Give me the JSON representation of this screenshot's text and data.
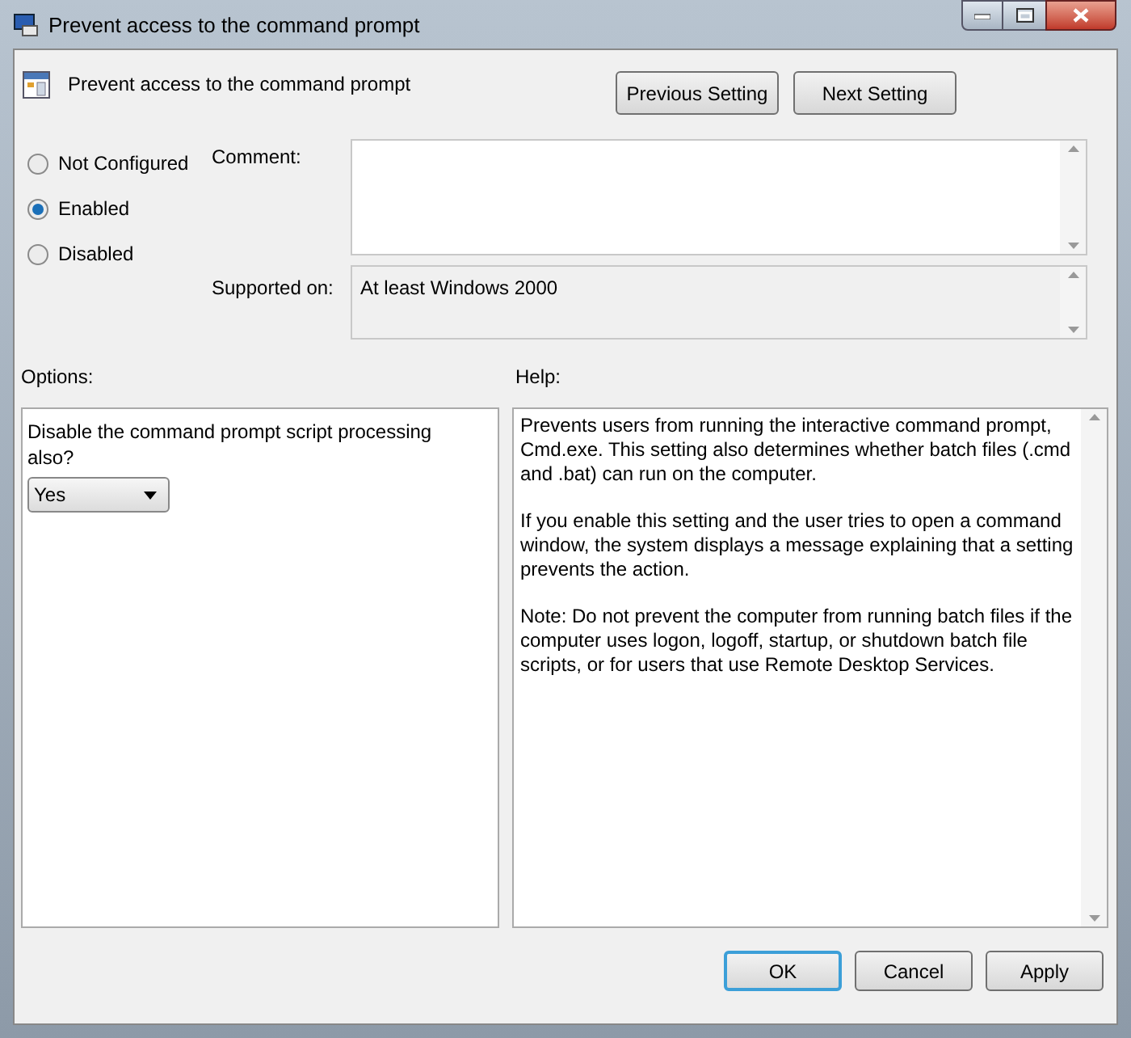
{
  "window": {
    "title": "Prevent access to the command prompt"
  },
  "header": {
    "title": "Prevent access to the command prompt"
  },
  "nav_buttons": [
    "Previous Setting",
    "Next Setting"
  ],
  "states": [
    {
      "label": "Not Configured",
      "selected": false
    },
    {
      "label": "Enabled",
      "selected": true
    },
    {
      "label": "Disabled",
      "selected": false
    }
  ],
  "comment": {
    "label": "Comment:"
  },
  "supported_on": {
    "label": "Supported on:",
    "value": "At least Windows 2000"
  },
  "options": {
    "label": "Options:",
    "prompt": "Disable the command prompt script processing also?",
    "dropdown": "Yes"
  },
  "help": {
    "label": "Help:",
    "paragraphs": [
      "Prevents users from running the interactive command prompt, Cmd.exe. This setting also determines whether batch files (.cmd and .bat) can run on the computer.",
      "If you enable this setting and the user tries to open a command window, the system displays a message explaining that a setting prevents the action.",
      "Note: Do not prevent the computer from running batch files if the computer uses logon, logoff, startup, or shutdown batch file scripts, or for users that use Remote Desktop Services."
    ]
  },
  "buttons": [
    {
      "label": "OK",
      "default": true
    },
    {
      "label": "Cancel",
      "default": false
    },
    {
      "label": "Apply",
      "default": false
    }
  ]
}
